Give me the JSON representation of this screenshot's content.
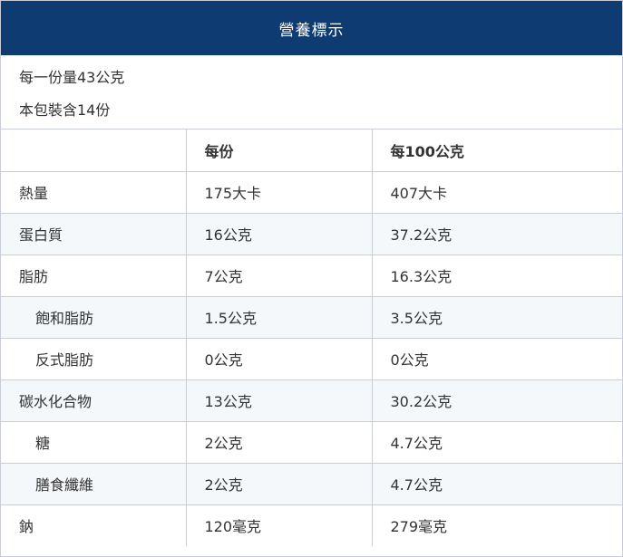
{
  "title": "營養標示",
  "serving": {
    "per_serving": "每一份量43公克",
    "servings_per_pack": "本包裝含14份"
  },
  "table": {
    "headers": [
      "",
      "每份",
      "每100公克"
    ],
    "rows": [
      {
        "name": "熱量",
        "per_serving": "175大卡",
        "per_100g": "407大卡",
        "indent": false
      },
      {
        "name": "蛋白質",
        "per_serving": "16公克",
        "per_100g": "37.2公克",
        "indent": false
      },
      {
        "name": "脂肪",
        "per_serving": "7公克",
        "per_100g": "16.3公克",
        "indent": false
      },
      {
        "name": "飽和脂肪",
        "per_serving": "1.5公克",
        "per_100g": "3.5公克",
        "indent": true
      },
      {
        "name": "反式脂肪",
        "per_serving": "0公克",
        "per_100g": "0公克",
        "indent": true
      },
      {
        "name": "碳水化合物",
        "per_serving": "13公克",
        "per_100g": "30.2公克",
        "indent": false
      },
      {
        "name": "糖",
        "per_serving": "2公克",
        "per_100g": "4.7公克",
        "indent": true
      },
      {
        "name": "膳食纖維",
        "per_serving": "2公克",
        "per_100g": "4.7公克",
        "indent": true
      },
      {
        "name": "鈉",
        "per_serving": "120毫克",
        "per_100g": "279毫克",
        "indent": false
      }
    ]
  },
  "colors": {
    "header_background": "#0f3b73",
    "border": "#c9ced6",
    "text": "#333333"
  }
}
